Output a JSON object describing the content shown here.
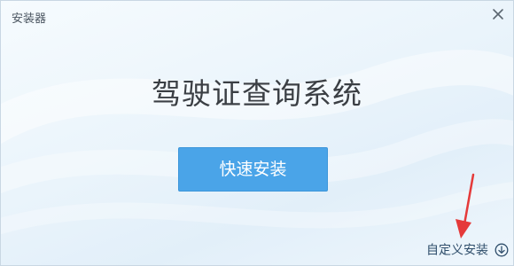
{
  "window": {
    "title": "安装器"
  },
  "main": {
    "app_name": "驾驶证查询系统"
  },
  "actions": {
    "quick_install": "快速安装",
    "custom_install": "自定义安装"
  },
  "icons": {
    "close": "close-icon",
    "custom_install": "chevron-circle-down-icon"
  },
  "colors": {
    "accent": "#4aa4e8",
    "annotation": "#e53a3a",
    "title_text": "#3b3f44"
  }
}
